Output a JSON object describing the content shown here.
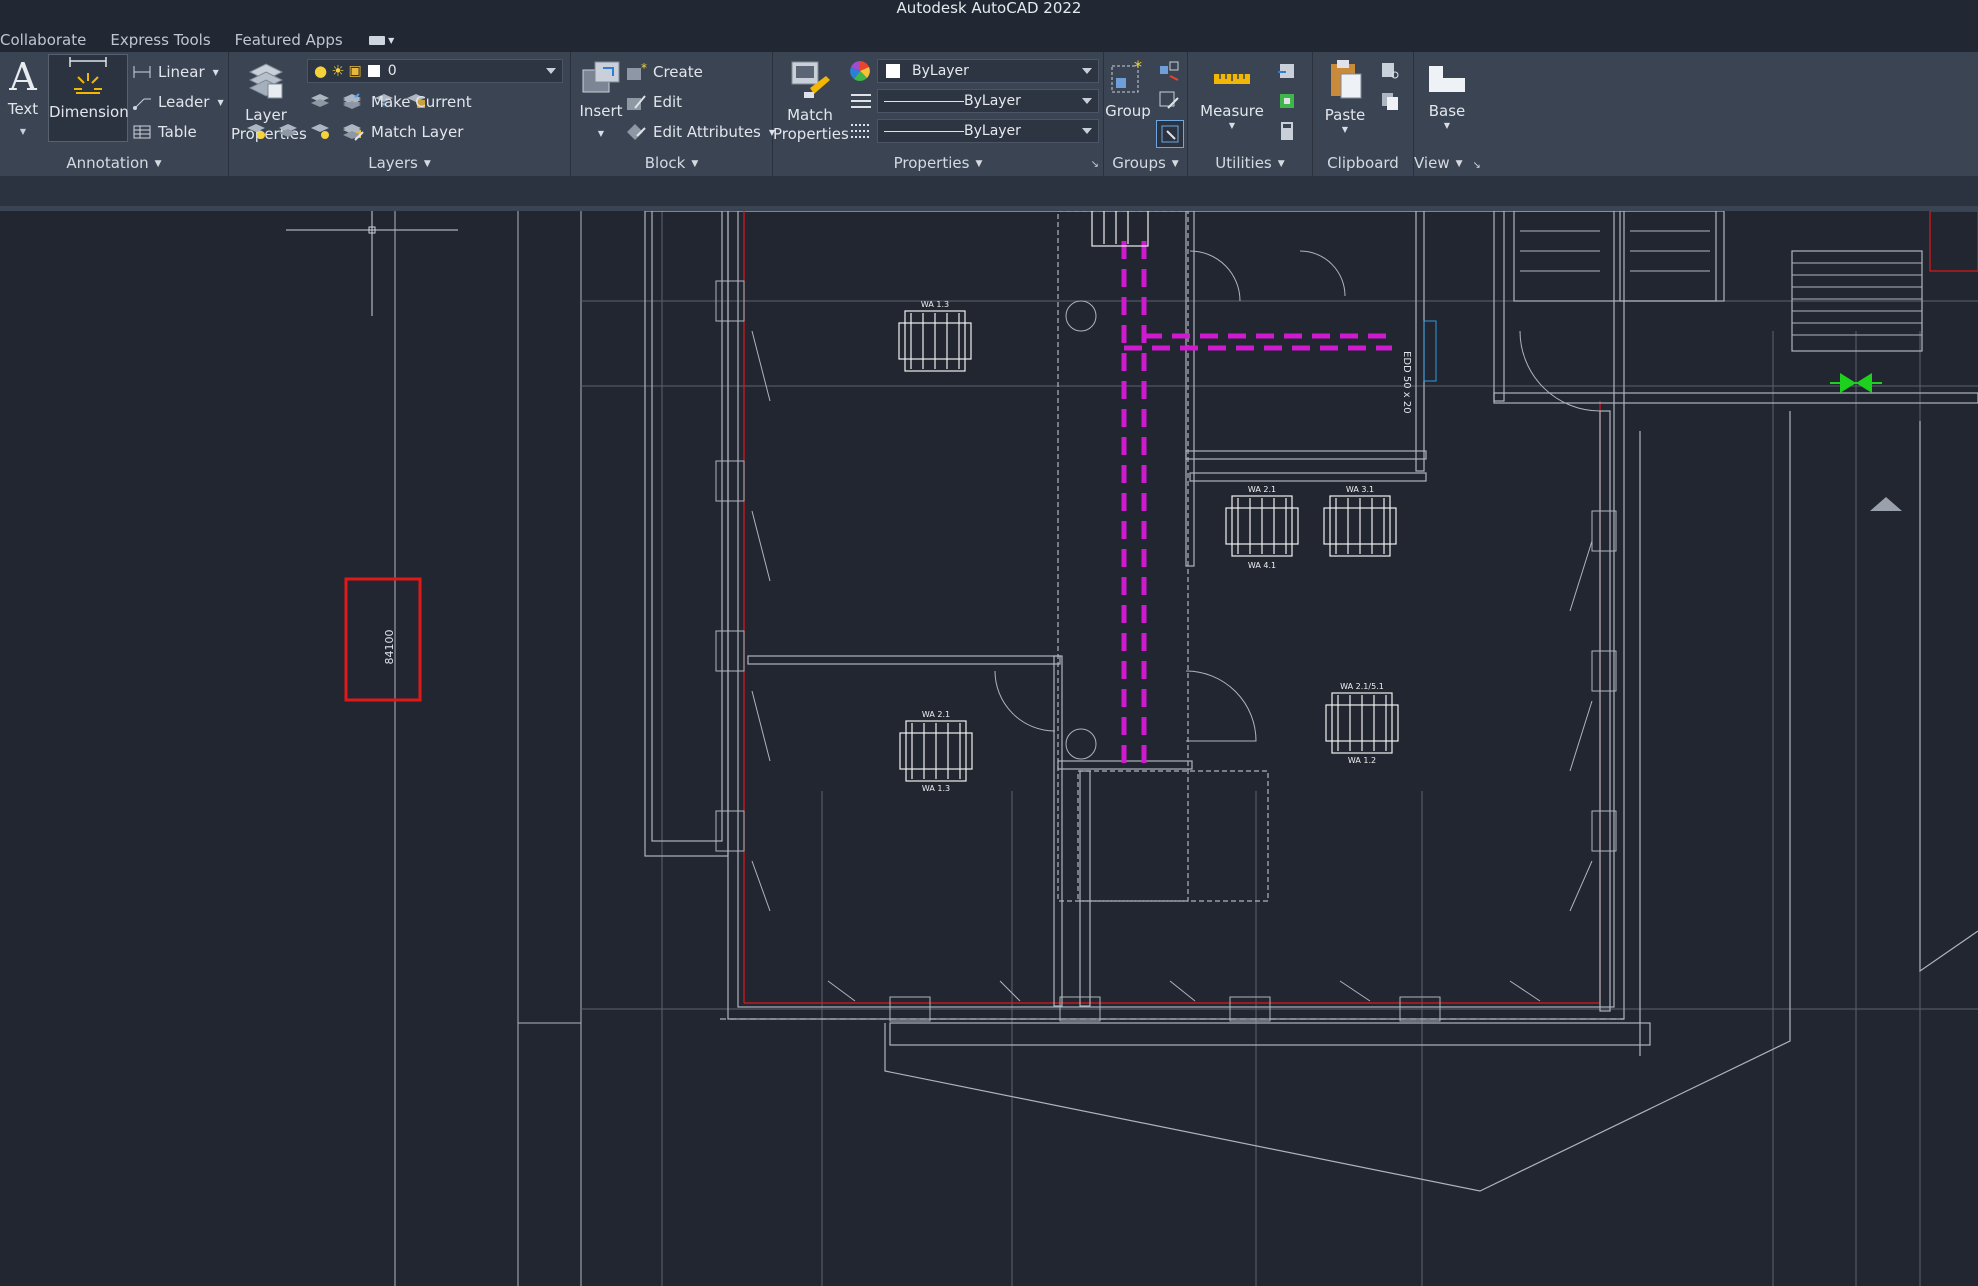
{
  "app": {
    "title": "Autodesk AutoCAD 2022"
  },
  "tabs": [
    {
      "label": "Collaborate"
    },
    {
      "label": "Express Tools"
    },
    {
      "label": "Featured Apps"
    }
  ],
  "ribbon": {
    "annotation": {
      "panel_label": "Annotation",
      "text_label": "Text",
      "dimension_label": "Dimension",
      "linear_label": "Linear",
      "leader_label": "Leader",
      "table_label": "Table"
    },
    "layers": {
      "panel_label": "Layers",
      "layer_properties_label": "Layer Properties",
      "current_layer": "0",
      "make_current_label": "Make Current",
      "match_layer_label": "Match Layer"
    },
    "block": {
      "panel_label": "Block",
      "insert_label": "Insert",
      "create_label": "Create",
      "edit_label": "Edit",
      "edit_attributes_label": "Edit Attributes"
    },
    "properties": {
      "panel_label": "Properties",
      "match_properties_label": "Match Properties",
      "color_value": "ByLayer",
      "linetype_value": "ByLayer",
      "lineweight_value": "ByLayer"
    },
    "groups": {
      "panel_label": "Groups",
      "group_label": "Group"
    },
    "utilities": {
      "panel_label": "Utilities",
      "measure_label": "Measure"
    },
    "clipboard": {
      "panel_label": "Clipboard",
      "paste_label": "Paste"
    },
    "view": {
      "panel_label": "View",
      "base_label": "Base"
    }
  },
  "drawing": {
    "room_tags": [
      "WA 1.3",
      "WA 2.1",
      "WA 3.1",
      "WA 4.1",
      "WA 2.1",
      "WA 1.3",
      "WA 2.1/5.1",
      "WA 1.2"
    ],
    "duct_label": "EDD 50 x 20",
    "dimension_text": "84100",
    "colors": {
      "canvas": "#212630",
      "duct": "#d01ad0",
      "highlight": "#e01818",
      "grid": "#5a6170",
      "wall": "#aeb4be",
      "marker": "#1fd11f"
    }
  }
}
